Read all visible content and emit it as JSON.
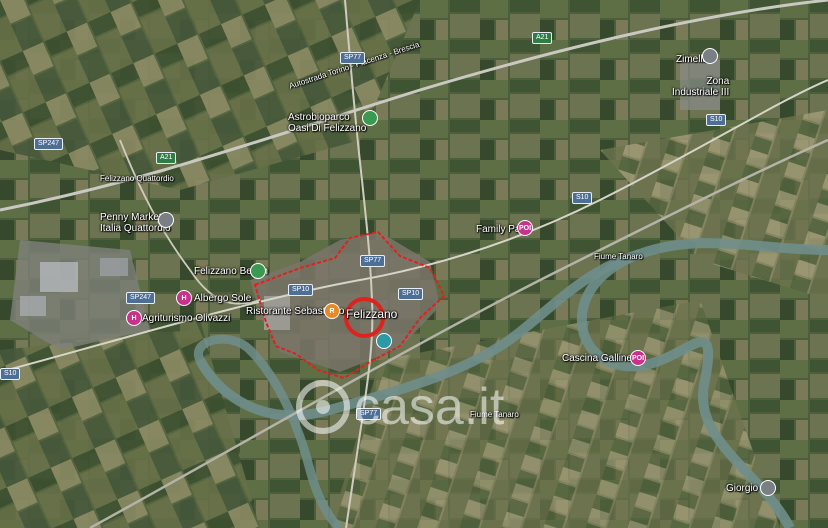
{
  "map": {
    "labels": {
      "autostrada": "Autostrada Torino - Piacenza - Brescia",
      "astrobioparco": "Astrobioparco\nOasi Di Felizzano",
      "zimella": "Zimella",
      "zona_industriale": "Zona\nIndustriale III",
      "felizzano_quattordio": "Felizzano Quattordio",
      "penny_market": "Penny Market\nItalia Quattordio",
      "felizzano_beach": "Felizzano Beach",
      "albergo_sole": "Albergo Sole",
      "agriturismo": "Agriturismo Olivazzi",
      "ristorante": "Ristorante Sebastiano",
      "felizzano": "Felizzano",
      "family_park": "Family Park",
      "fiume_tanaro": "Fiume Tanaro",
      "cascina": "Cascina Gallinette",
      "giorgio": "Giorgio"
    },
    "shields": {
      "sp77_top": "SP77",
      "a21_top": "A21",
      "sp247_left": "SP247",
      "a21_left": "A21",
      "s10_right": "S10",
      "s10_mid": "S10",
      "sp77_town": "SP77",
      "sp247_town": "SP247",
      "sp10_town": "SP10",
      "sp10_east": "SP10",
      "s10_left": "S10",
      "sp77_south": "SP77"
    },
    "pin_icons": {
      "hotel": "H",
      "poi": "POI",
      "restaurant": "R"
    },
    "watermark": "casa.it",
    "colors": {
      "fields": "#4a5a3a",
      "river": "#6f8e8b",
      "town_boundary": "#e0221e"
    }
  }
}
